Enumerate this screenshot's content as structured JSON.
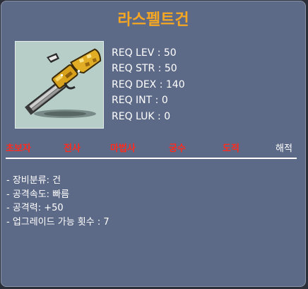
{
  "item": {
    "name": "라스펠트건",
    "icon": "pistol-icon"
  },
  "requirements": [
    {
      "label": "REQ LEV",
      "value": "50",
      "text": "REQ LEV : 50"
    },
    {
      "label": "REQ STR",
      "value": "50",
      "text": "REQ STR : 50"
    },
    {
      "label": "REQ DEX",
      "value": "140",
      "text": "REQ DEX : 140"
    },
    {
      "label": "REQ INT",
      "value": "0",
      "text": "REQ INT : 0"
    },
    {
      "label": "REQ LUK",
      "value": "0",
      "text": "REQ LUK : 0"
    }
  ],
  "jobs": [
    {
      "label": "초보자",
      "available": false
    },
    {
      "label": "전사",
      "available": false
    },
    {
      "label": "마법사",
      "available": false
    },
    {
      "label": "궁수",
      "available": false
    },
    {
      "label": "도적",
      "available": false
    },
    {
      "label": "해적",
      "available": true
    }
  ],
  "stats": [
    "- 장비분류: 건",
    "- 공격속도: 빠름",
    "- 공격력: +50",
    "- 업그레이드 가능 횟수 : 7"
  ],
  "colors": {
    "background": "#5d6a87",
    "item_name": "#f5a623",
    "job_unavailable": "#ff2a1d",
    "job_available": "#ffffff"
  }
}
